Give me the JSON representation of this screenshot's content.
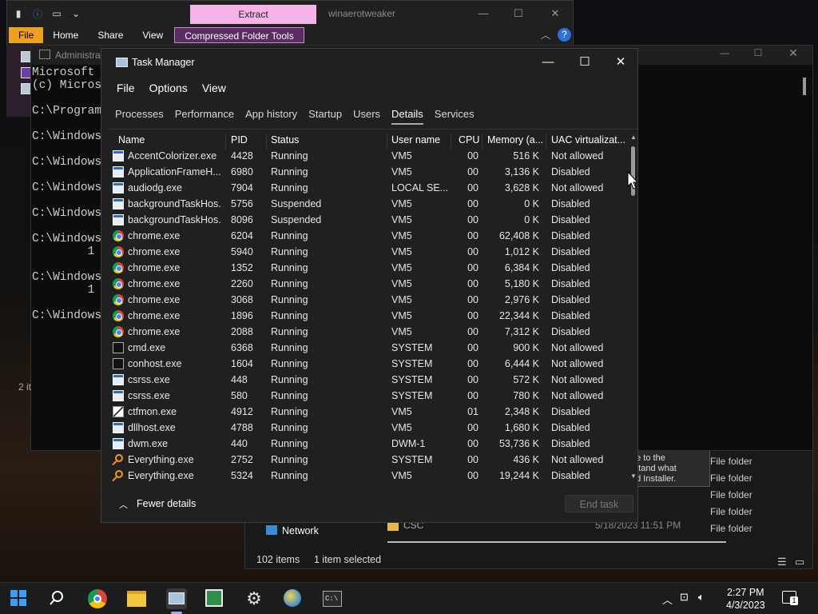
{
  "explorer": {
    "title": "winaerotweaker",
    "context_tab": "Extract",
    "ribbon_tabs": [
      "File",
      "Home",
      "Share",
      "View",
      "Compressed Folder Tools"
    ],
    "status_items": "2 it"
  },
  "cmd": {
    "title": "Administrato",
    "lines": [
      "Microsoft Wi",
      "(c) Microsof",
      "",
      "C:\\Program F",
      "",
      "C:\\Windows\\S",
      "",
      "C:\\Windows\\S",
      "",
      "C:\\Windows\\S",
      "",
      "C:\\Windows\\S",
      "",
      "C:\\Windows\\S",
      "        1 fi",
      "",
      "C:\\Windows\\S",
      "        1 fi",
      "",
      "C:\\Windows\\S"
    ]
  },
  "explorer2": {
    "nav_network": "Network",
    "item_count": "102 items",
    "selected": "1 item selected",
    "folder_name": "CSC",
    "folder_date": "5/18/2023 11:51 PM",
    "type_labels": [
      "File folder",
      "File folder",
      "File folder",
      "File folder",
      "File folder"
    ],
    "tip_lines": [
      "ge to the",
      "rstand what",
      "ed Installer."
    ]
  },
  "taskmgr": {
    "title": "Task Manager",
    "menu": [
      "File",
      "Options",
      "View"
    ],
    "tabs": [
      "Processes",
      "Performance",
      "App history",
      "Startup",
      "Users",
      "Details",
      "Services"
    ],
    "active_tab": "Details",
    "columns": [
      "Name",
      "PID",
      "Status",
      "User name",
      "CPU",
      "Memory (a...",
      "UAC virtualizat..."
    ],
    "rows": [
      {
        "icon": "app",
        "name": "AccentColorizer.exe",
        "pid": "4428",
        "status": "Running",
        "user": "VM5",
        "cpu": "00",
        "mem": "516 K",
        "uac": "Not allowed"
      },
      {
        "icon": "app",
        "name": "ApplicationFrameH...",
        "pid": "6980",
        "status": "Running",
        "user": "VM5",
        "cpu": "00",
        "mem": "3,136 K",
        "uac": "Disabled"
      },
      {
        "icon": "app",
        "name": "audiodg.exe",
        "pid": "7904",
        "status": "Running",
        "user": "LOCAL SE...",
        "cpu": "00",
        "mem": "3,628 K",
        "uac": "Not allowed"
      },
      {
        "icon": "app",
        "name": "backgroundTaskHos...",
        "pid": "5756",
        "status": "Suspended",
        "user": "VM5",
        "cpu": "00",
        "mem": "0 K",
        "uac": "Disabled"
      },
      {
        "icon": "app",
        "name": "backgroundTaskHos...",
        "pid": "8096",
        "status": "Suspended",
        "user": "VM5",
        "cpu": "00",
        "mem": "0 K",
        "uac": "Disabled"
      },
      {
        "icon": "chrome",
        "name": "chrome.exe",
        "pid": "6204",
        "status": "Running",
        "user": "VM5",
        "cpu": "00",
        "mem": "62,408 K",
        "uac": "Disabled"
      },
      {
        "icon": "chrome",
        "name": "chrome.exe",
        "pid": "5940",
        "status": "Running",
        "user": "VM5",
        "cpu": "00",
        "mem": "1,012 K",
        "uac": "Disabled"
      },
      {
        "icon": "chrome",
        "name": "chrome.exe",
        "pid": "1352",
        "status": "Running",
        "user": "VM5",
        "cpu": "00",
        "mem": "6,384 K",
        "uac": "Disabled"
      },
      {
        "icon": "chrome",
        "name": "chrome.exe",
        "pid": "2260",
        "status": "Running",
        "user": "VM5",
        "cpu": "00",
        "mem": "5,180 K",
        "uac": "Disabled"
      },
      {
        "icon": "chrome",
        "name": "chrome.exe",
        "pid": "3068",
        "status": "Running",
        "user": "VM5",
        "cpu": "00",
        "mem": "2,976 K",
        "uac": "Disabled"
      },
      {
        "icon": "chrome",
        "name": "chrome.exe",
        "pid": "1896",
        "status": "Running",
        "user": "VM5",
        "cpu": "00",
        "mem": "22,344 K",
        "uac": "Disabled"
      },
      {
        "icon": "chrome",
        "name": "chrome.exe",
        "pid": "2088",
        "status": "Running",
        "user": "VM5",
        "cpu": "00",
        "mem": "7,312 K",
        "uac": "Disabled"
      },
      {
        "icon": "cmd",
        "name": "cmd.exe",
        "pid": "6368",
        "status": "Running",
        "user": "SYSTEM",
        "cpu": "00",
        "mem": "900 K",
        "uac": "Not allowed"
      },
      {
        "icon": "cmd",
        "name": "conhost.exe",
        "pid": "1604",
        "status": "Running",
        "user": "SYSTEM",
        "cpu": "00",
        "mem": "6,444 K",
        "uac": "Not allowed"
      },
      {
        "icon": "app",
        "name": "csrss.exe",
        "pid": "448",
        "status": "Running",
        "user": "SYSTEM",
        "cpu": "00",
        "mem": "572 K",
        "uac": "Not allowed"
      },
      {
        "icon": "app",
        "name": "csrss.exe",
        "pid": "580",
        "status": "Running",
        "user": "SYSTEM",
        "cpu": "00",
        "mem": "780 K",
        "uac": "Not allowed"
      },
      {
        "icon": "pen",
        "name": "ctfmon.exe",
        "pid": "4912",
        "status": "Running",
        "user": "VM5",
        "cpu": "01",
        "mem": "2,348 K",
        "uac": "Disabled"
      },
      {
        "icon": "app",
        "name": "dllhost.exe",
        "pid": "4788",
        "status": "Running",
        "user": "VM5",
        "cpu": "00",
        "mem": "1,680 K",
        "uac": "Disabled"
      },
      {
        "icon": "app",
        "name": "dwm.exe",
        "pid": "440",
        "status": "Running",
        "user": "DWM-1",
        "cpu": "00",
        "mem": "53,736 K",
        "uac": "Disabled"
      },
      {
        "icon": "mag",
        "name": "Everything.exe",
        "pid": "2752",
        "status": "Running",
        "user": "SYSTEM",
        "cpu": "00",
        "mem": "436 K",
        "uac": "Not allowed"
      },
      {
        "icon": "mag",
        "name": "Everything.exe",
        "pid": "5324",
        "status": "Running",
        "user": "VM5",
        "cpu": "00",
        "mem": "19,244 K",
        "uac": "Disabled"
      }
    ],
    "fewer_details": "Fewer details",
    "end_task": "End task"
  },
  "taskbar": {
    "time": "2:27 PM",
    "date": "4/3/2023",
    "notif_count": "1",
    "apps": [
      "start-icon",
      "search-icon",
      "chrome-icon",
      "file-explorer-icon",
      "task-manager-icon",
      "notepad-icon",
      "settings-icon",
      "winaero-icon",
      "cmd-icon"
    ]
  }
}
